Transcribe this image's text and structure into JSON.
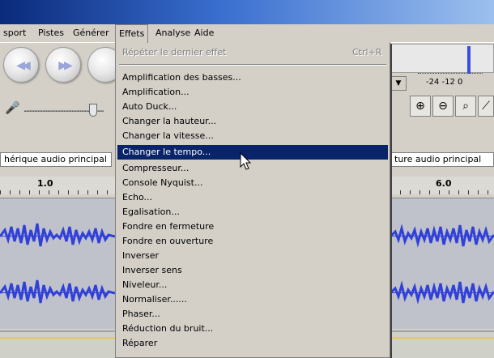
{
  "menubar": {
    "items": [
      {
        "label": "sport"
      },
      {
        "label": "Pistes"
      },
      {
        "label": "Générer"
      },
      {
        "label": "Effets"
      },
      {
        "label": "Analyse"
      },
      {
        "label": "Aide"
      }
    ]
  },
  "effects_menu": {
    "repeat_label": "Répéter le dernier effet",
    "repeat_shortcut": "Ctrl+R",
    "items": [
      "Amplification des basses...",
      "Amplification...",
      "Auto Duck...",
      "Changer la hauteur...",
      "Changer la vitesse...",
      "Changer le tempo...",
      "Compresseur...",
      "Console Nyquist...",
      "Echo...",
      "Egalisation...",
      "Fondre en fermeture",
      "Fondre en ouverture",
      "Inverser",
      "Inverser sens",
      "Niveleur...",
      "Normaliser......",
      "Phaser...",
      "Réduction du bruit...",
      "Réparer"
    ],
    "selected_index": 5
  },
  "meter": {
    "scale": "-24  -12  0"
  },
  "tracks": {
    "left_name": "hérique audio principal",
    "right_name": "ture audio principal"
  },
  "ruler": {
    "left_label": "1.0",
    "right_label": "6.0"
  },
  "colors": {
    "menu_highlight": "#0a246a",
    "waveform": "#3040d8",
    "track_background": "#bfc2ca"
  }
}
